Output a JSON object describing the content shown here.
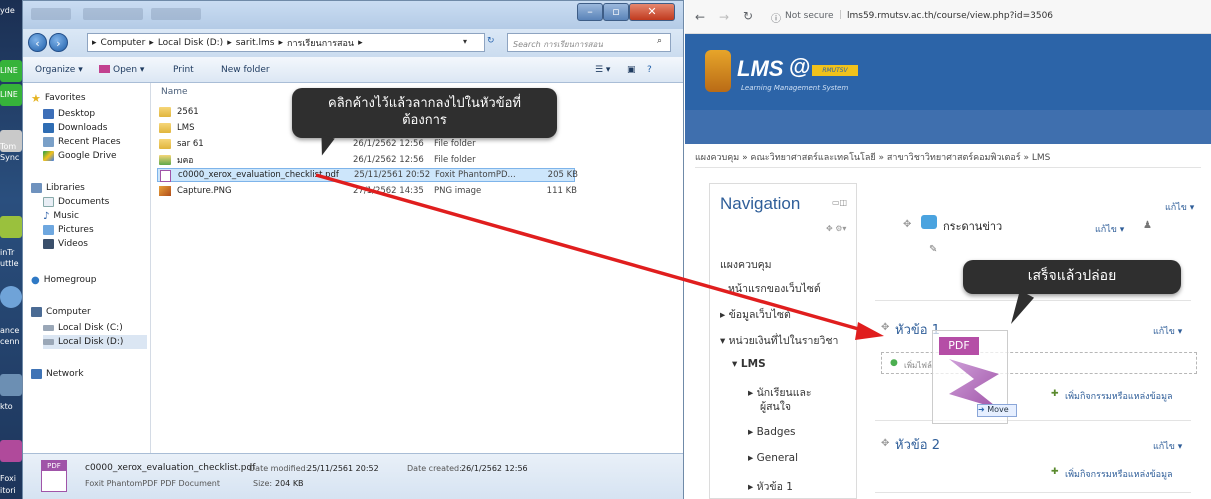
{
  "desktop": {
    "labels": [
      "yde",
      "LINE",
      "LINE",
      "Tom",
      "Sync",
      "inTr",
      "uttle",
      "ance",
      "cenn",
      "kto",
      "Foxi",
      "itori"
    ]
  },
  "explorer": {
    "breadcrumb": [
      "Computer",
      "Local Disk (D:)",
      "sarit.lms",
      "การเรียนการสอน"
    ],
    "search_placeholder": "Search การเรียนการสอน",
    "toolbar": {
      "organize": "Organize",
      "open": "Open",
      "print": "Print",
      "new_folder": "New folder"
    },
    "nav": {
      "favorites": "Favorites",
      "fav_items": [
        "Desktop",
        "Downloads",
        "Recent Places",
        "Google Drive"
      ],
      "libraries": "Libraries",
      "lib_items": [
        "Documents",
        "Music",
        "Pictures",
        "Videos"
      ],
      "homegroup": "Homegroup",
      "computer": "Computer",
      "drives": [
        "Local Disk (C:)",
        "Local Disk (D:)"
      ],
      "network": "Network"
    },
    "columns": {
      "name": "Name"
    },
    "files": [
      {
        "name": "2561",
        "date": "",
        "type": "",
        "size": ""
      },
      {
        "name": "LMS",
        "date": "",
        "type": "",
        "size": ""
      },
      {
        "name": "sar 61",
        "date": "26/1/2562 12:56",
        "type": "File folder",
        "size": ""
      },
      {
        "name": "มคอ",
        "date": "26/1/2562 12:56",
        "type": "File folder",
        "size": ""
      },
      {
        "name": "c0000_xerox_evaluation_checklist.pdf",
        "date": "25/11/2561 20:52",
        "type": "Foxit PhantomPD...",
        "size": "205 KB"
      },
      {
        "name": "Capture.PNG",
        "date": "27/1/2562 14:35",
        "type": "PNG image",
        "size": "111 KB"
      }
    ],
    "details": {
      "filename": "c0000_xerox_evaluation_checklist.pdf",
      "date_modified_label": "Date modified:",
      "date_modified": "25/11/2561 20:52",
      "date_created_label": "Date created:",
      "date_created": "26/1/2562 12:56",
      "type": "Foxit PhantomPDF PDF Document",
      "size_label": "Size:",
      "size": "204 KB",
      "icon_text": "PDF"
    }
  },
  "callout_drag": {
    "line1": "คลิกค้างไว้แล้วลากลงไปในหัวข้อที่",
    "line2": "ต้องการ"
  },
  "callout_drop": {
    "text": "เสร็จแล้วปล่อย"
  },
  "browser": {
    "not_secure": "Not secure",
    "url": "lms59.rmutsv.ac.th/course/view.php?id=3506",
    "logo_text": "LMS",
    "logo_at": "@",
    "logo_sub": "Learning Management System",
    "logo_badge": "RMUTSV",
    "breadcrumb": "แผงควบคุม » คณะวิทยาศาสตร์และเทคโนโลยี » สาขาวิชาวิทยาศาสตร์คอมพิวเตอร์ » LMS",
    "nav_title": "Navigation",
    "nav_items": [
      "แผงควบคุม",
      "หน้าแรกของเว็บไซต์",
      "▸ ข้อมูลเว็บไซต์",
      "▾ หน่วยเงินที่ไปในรายวิชา",
      "▾ LMS",
      "▸ นักเรียนและ",
      "ผู้สนใจ",
      "▸ Badges",
      "▸ General",
      "▸ หัวข้อ 1"
    ],
    "edit": "แก้ไข ▾",
    "forum": "กระดานข่าว",
    "section1": "หัวข้อ 1",
    "section2": "หัวข้อ 2",
    "add_activity": "เพิ่มกิจกรรมหรือแหล่งข้อมูล",
    "add_file_hint": "เพิ่มไฟล์",
    "drag_pdf_label": "PDF",
    "move_label": "Move"
  },
  "colors": {
    "lms_blue": "#2c64a8",
    "arrow_red": "#e01e1e",
    "callout_bg": "#2f2f2f",
    "explorer_frame": "#cfe0f1"
  }
}
